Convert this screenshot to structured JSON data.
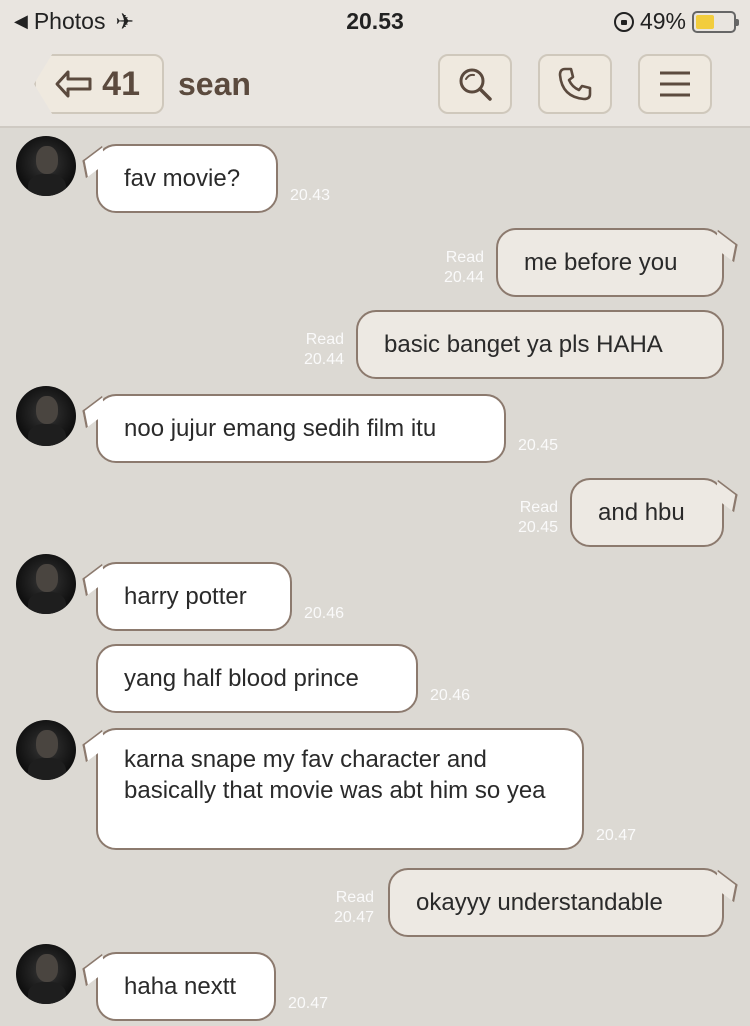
{
  "status_bar": {
    "back_app": "Photos",
    "time": "20.53",
    "battery_percent": "49%",
    "battery_level": 0.49
  },
  "header": {
    "back_count": "41",
    "contact_name": "sean"
  },
  "messages": [
    {
      "text": "fav movie?",
      "time": "20.43"
    },
    {
      "text": "me before you",
      "status": "Read",
      "time": "20.44"
    },
    {
      "text": "basic banget ya pls HAHA",
      "status": "Read",
      "time": "20.44"
    },
    {
      "text": "noo jujur emang sedih film itu",
      "time": "20.45"
    },
    {
      "text": "and hbu",
      "status": "Read",
      "time": "20.45"
    },
    {
      "text": "harry potter",
      "time": "20.46"
    },
    {
      "text": "yang half blood prince",
      "time": "20.46"
    },
    {
      "text": "karna snape my fav character and basically that movie was abt him so yea",
      "time": "20.47"
    },
    {
      "text": "okayyy understandable",
      "status": "Read",
      "time": "20.47"
    },
    {
      "text": "haha nextt",
      "time": "20.47"
    }
  ]
}
